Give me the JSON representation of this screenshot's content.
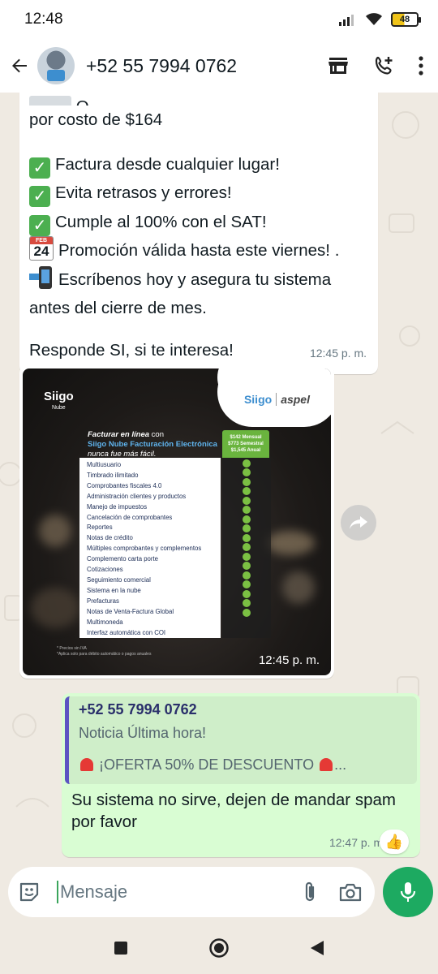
{
  "status_bar": {
    "time": "12:48",
    "battery": "48"
  },
  "header": {
    "contact": "+52 55 7994 0762"
  },
  "message_in": {
    "cut_line": "Q...",
    "lines": [
      "por costo de $164",
      "Factura desde cualquier lugar!",
      "Evita retrasos y errores!",
      "Cumple al 100% con el SAT!",
      "Promoción válida hasta este viernes! .",
      "Escríbenos hoy y asegura tu sistema",
      "antes del cierre de mes.",
      "Responde SI, si te interesa!"
    ],
    "calendar_day": "24",
    "time": "12:45 p. m."
  },
  "promo_image": {
    "brand_left": "Siigo",
    "brand_left_sub": "Nube",
    "brand_right_a": "Siigo",
    "brand_right_b": "aspel",
    "headline_a": "Facturar en línea",
    "headline_b": "con",
    "headline_c": "Siigo Nube Facturación Electrónica",
    "headline_d": "nunca fue más fácil.",
    "price_1": "$142 Mensual",
    "price_2": "$773 Semestral",
    "price_3": "$1,545 Anual",
    "features": [
      "Multiusuario",
      "Timbrado ilimitado",
      "Comprobantes fiscales 4.0",
      "Administración clientes y productos",
      "Manejo de impuestos",
      "Cancelación de comprobantes",
      "Reportes",
      "Notas de crédito",
      "Múltiples comprobantes y complementos",
      "Complemento carta porte",
      "Cotizaciones",
      "Seguimiento comercial",
      "Sistema en la nube",
      "Prefacturas",
      "Notas de Venta-Factura Global",
      "Multimoneda",
      "Interfaz automática con COI"
    ],
    "fineprint_1": "* Precios sin IVA",
    "fineprint_2": "*Aplica solo para débito automático o pagos anuales",
    "time": "12:45 p. m."
  },
  "message_out": {
    "quote_name": "+52 55 7994 0762",
    "quote_line": "Noticia Última hora!",
    "quote_offer": "¡OFERTA 50% DE DESCUENTO",
    "quote_ellipsis": "...",
    "text": "Su sistema no sirve, dejen de mandar spam por favor",
    "time": "12:47 p. m.",
    "reaction": "👍"
  },
  "composer": {
    "placeholder": "Mensaje"
  },
  "colors": {
    "accent": "#1daa61",
    "bubble_out": "#d9fdd3",
    "quote_bar": "#5b54c2"
  }
}
